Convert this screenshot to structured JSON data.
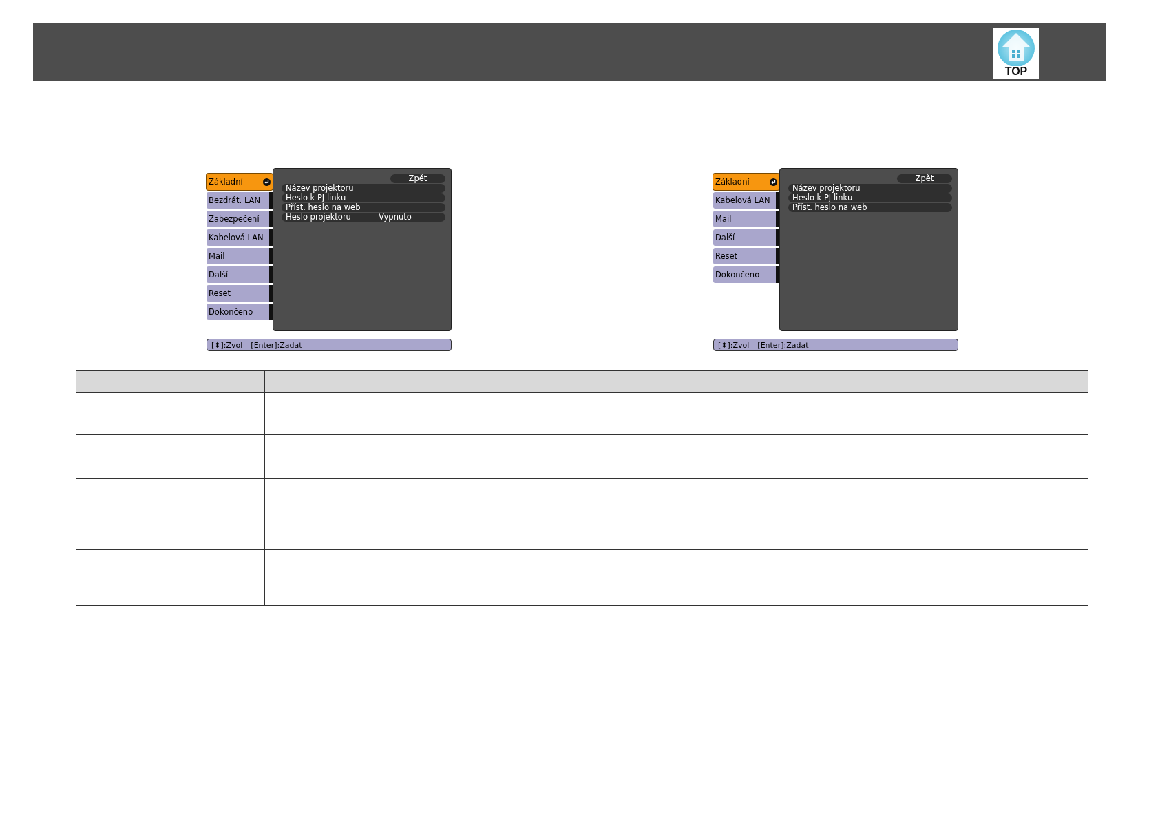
{
  "header": {
    "top_link": "TOP"
  },
  "menus": [
    {
      "sidebar": [
        {
          "label": "Základní",
          "selected": true
        },
        {
          "label": "Bezdrát. LAN",
          "selected": false
        },
        {
          "label": "Zabezpečení",
          "selected": false
        },
        {
          "label": "Kabelová LAN",
          "selected": false
        },
        {
          "label": "Mail",
          "selected": false
        },
        {
          "label": "Další",
          "selected": false
        },
        {
          "label": "Reset",
          "selected": false
        },
        {
          "label": "Dokončeno",
          "selected": false
        }
      ],
      "back": "Zpět",
      "rows": [
        {
          "label": "Název projektoru"
        },
        {
          "label": "Heslo k PJ linku"
        },
        {
          "label": "Příst. heslo na web"
        },
        {
          "label": "Heslo projektoru",
          "value": "Vypnuto"
        }
      ],
      "hints": [
        "[⬍]:Zvol",
        "[Enter]:Zadat"
      ]
    },
    {
      "sidebar": [
        {
          "label": "Základní",
          "selected": true
        },
        {
          "label": "Kabelová LAN",
          "selected": false
        },
        {
          "label": "Mail",
          "selected": false
        },
        {
          "label": "Další",
          "selected": false
        },
        {
          "label": "Reset",
          "selected": false
        },
        {
          "label": "Dokončeno",
          "selected": false
        }
      ],
      "back": "Zpět",
      "rows": [
        {
          "label": "Název projektoru"
        },
        {
          "label": "Heslo k PJ linku"
        },
        {
          "label": "Příst. heslo na web"
        }
      ],
      "hints": [
        "[⬍]:Zvol",
        "[Enter]:Zadat"
      ]
    }
  ]
}
